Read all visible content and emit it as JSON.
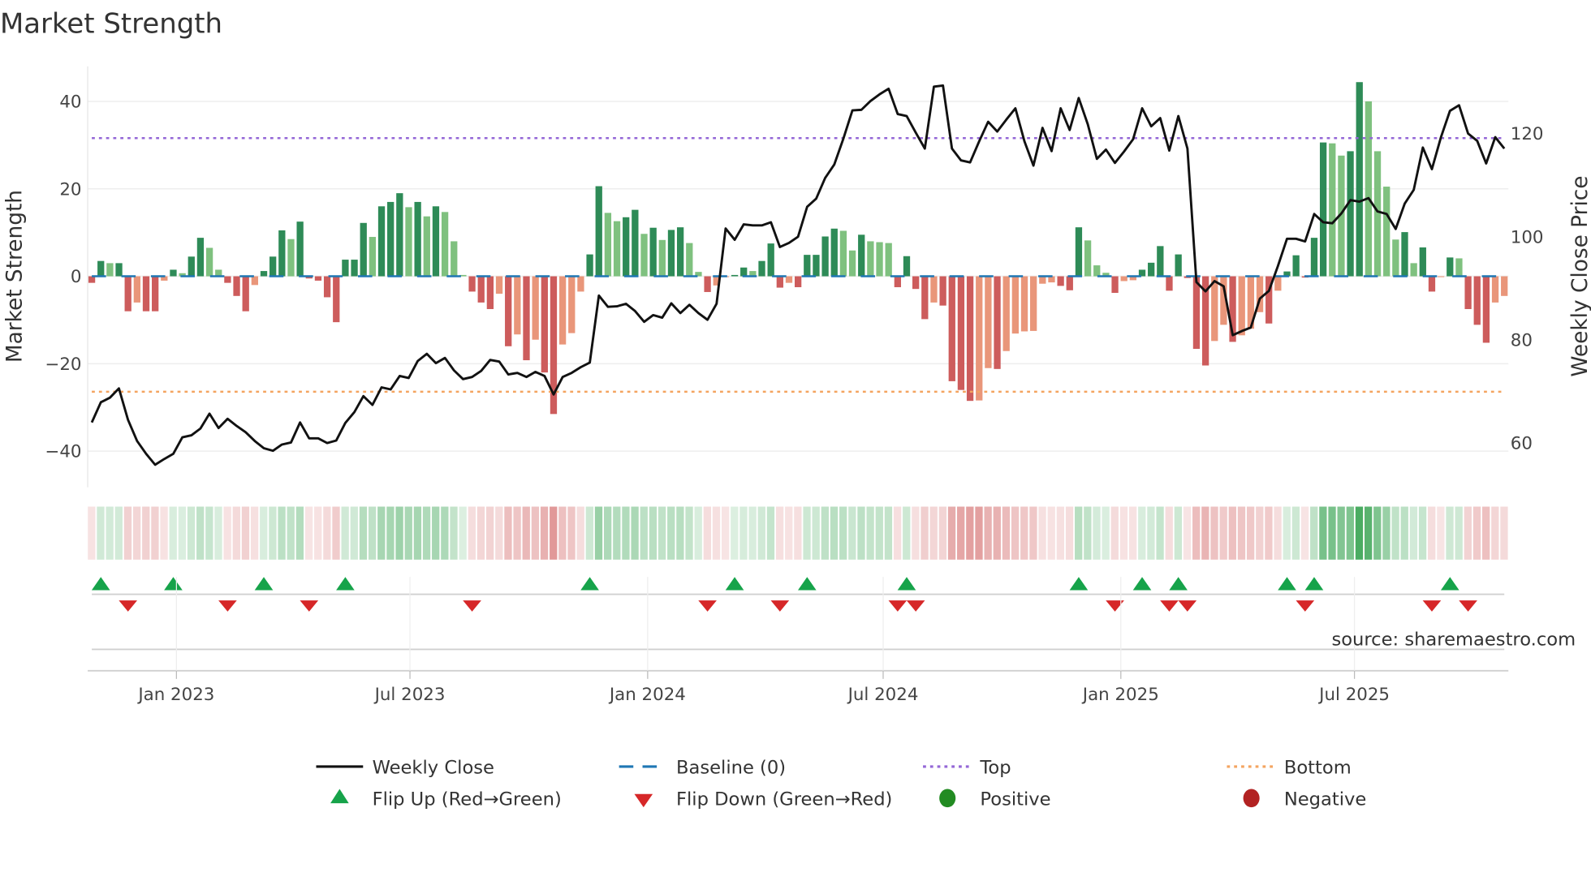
{
  "chart_data": {
    "type": "bar",
    "title": "Market Strength",
    "ylabel": "Market Strength",
    "y2label": "Weekly Close Price",
    "frequency": "weekly",
    "ylim": [
      -48,
      48
    ],
    "y2lim": [
      52,
      136
    ],
    "y_ticks": [
      40,
      20,
      0,
      -20,
      -40
    ],
    "y_tick_labels": [
      "40",
      "20",
      "0",
      "−20",
      "−40"
    ],
    "y2_ticks": [
      120,
      100,
      80,
      60
    ],
    "y2_tick_labels": [
      "120",
      "100",
      "80",
      "60"
    ],
    "x_ticks": [
      {
        "label": "Jan 2023",
        "week": 9.35
      },
      {
        "label": "Jul 2023",
        "week": 35.14
      },
      {
        "label": "Jan 2024",
        "week": 61.39
      },
      {
        "label": "Jul 2024",
        "week": 87.4
      },
      {
        "label": "Jan 2025",
        "week": 113.65
      },
      {
        "label": "Jul 2025",
        "week": 139.45
      }
    ],
    "top_level": 31.6,
    "bottom_level": -26.4,
    "baseline": 0,
    "strength": [
      -1.5,
      3.5,
      3,
      3,
      -8,
      -6,
      -8,
      -8,
      -1,
      1.5,
      0.7,
      4.5,
      8.8,
      6.5,
      1.5,
      -1.5,
      -4.5,
      -8,
      -2,
      1.2,
      4.5,
      10.5,
      8.5,
      12.5,
      -0.5,
      -1,
      -4.8,
      -10.5,
      3.8,
      3.8,
      12.2,
      9,
      16,
      17,
      19,
      15.8,
      17,
      13.7,
      16,
      14.7,
      8,
      0.3,
      -3.5,
      -6,
      -7.5,
      -4,
      -16,
      -13.3,
      -19.2,
      -14.5,
      -22,
      -31.5,
      -15.6,
      -13,
      -3.5,
      5,
      20.6,
      14.5,
      12.6,
      13.5,
      15.2,
      9.7,
      11.1,
      8.3,
      10.6,
      11.2,
      7.6,
      1,
      -3.6,
      -2.1,
      -0.2,
      0.3,
      2,
      1.2,
      3.5,
      7.5,
      -2.6,
      -1.5,
      -2.5,
      4.9,
      4.9,
      9.1,
      10.9,
      10.4,
      5.9,
      9.5,
      8,
      7.8,
      7.6,
      -2.5,
      4.6,
      -2.9,
      -9.8,
      -6,
      -6.7,
      -24,
      -26,
      -28.5,
      -28.4,
      -21,
      -21.2,
      -17.1,
      -13.1,
      -12.6,
      -12.5,
      -1.7,
      -1.4,
      -2.2,
      -3.2,
      11.2,
      8.2,
      2.5,
      0.8,
      -3.8,
      -1.1,
      -0.9,
      1.5,
      3.1,
      6.9,
      -3.3,
      5,
      -0.4,
      -16.6,
      -20.4,
      -14.8,
      -11.1,
      -15,
      -13.5,
      -12,
      -8.2,
      -10.8,
      -3.3,
      1.1,
      4.8,
      -0.3,
      8.8,
      30.6,
      30.4,
      27.6,
      28.6,
      44.4,
      40,
      28.6,
      20.5,
      8.4,
      10.1,
      3,
      6.6,
      -3.5,
      -0.2,
      4.3,
      4.1,
      -7.5,
      -11.1,
      -15.2,
      -6,
      -4.5
    ],
    "weekly_close": [
      64.0,
      67.9,
      68.8,
      70.6,
      64.5,
      60.4,
      57.9,
      55.8,
      56.9,
      57.9,
      61.1,
      61.5,
      62.8,
      65.7,
      62.9,
      64.7,
      63.3,
      62.1,
      60.4,
      59.0,
      58.5,
      59.7,
      60.1,
      64.0,
      60.9,
      60.9,
      60.0,
      60.5,
      63.9,
      66.0,
      69.1,
      67.4,
      70.8,
      70.4,
      73.0,
      72.6,
      75.9,
      77.3,
      75.5,
      76.5,
      74.1,
      72.4,
      72.8,
      74.0,
      76.1,
      75.8,
      73.3,
      73.6,
      72.8,
      73.8,
      73.0,
      69.4,
      72.8,
      73.6,
      74.7,
      75.6,
      88.6,
      86.4,
      86.5,
      87.0,
      85.6,
      83.5,
      84.8,
      84.3,
      87.1,
      85.2,
      86.8,
      85.2,
      83.9,
      87.0,
      101.6,
      99.4,
      102.4,
      102.2,
      102.2,
      102.8,
      98.0,
      98.8,
      100.0,
      105.8,
      107.4,
      111.4,
      114.0,
      119.0,
      124.5,
      124.6,
      126.3,
      127.6,
      128.7,
      123.8,
      123.4,
      120.2,
      117.1,
      129.1,
      129.3,
      117.1,
      114.8,
      114.4,
      118.5,
      122.3,
      120.4,
      122.7,
      124.9,
      118.5,
      113.8,
      121.1,
      116.6,
      124.9,
      120.7,
      126.9,
      121.8,
      115.1,
      116.9,
      114.3,
      116.5,
      118.9,
      124.9,
      121.4,
      123.0,
      116.7,
      123.4,
      117.1,
      91.2,
      89.4,
      91.4,
      90.4,
      80.9,
      81.7,
      82.4,
      88.0,
      89.5,
      94.3,
      99.6,
      99.6,
      99.1,
      104.4,
      102.8,
      102.6,
      104.5,
      107.1,
      106.8,
      107.5,
      104.9,
      104.4,
      101.5,
      106.4,
      109.1,
      117.3,
      113.1,
      119.3,
      124.4,
      125.5,
      120.0,
      118.6,
      114.2,
      119.3,
      117.1
    ],
    "flip_up_weeks": [
      1,
      9,
      19,
      28,
      55,
      71,
      79,
      90,
      109,
      116,
      120,
      132,
      135,
      150
    ],
    "flip_down_weeks": [
      4,
      15,
      24,
      42,
      68,
      76,
      89,
      91,
      113,
      119,
      121,
      134,
      148,
      152
    ],
    "legend": {
      "weekly_close": "Weekly Close",
      "baseline": "Baseline (0)",
      "top": "Top",
      "bottom": "Bottom",
      "flip_up": "Flip Up (Red→Green)",
      "flip_down": "Flip Down (Green→Red)",
      "positive": "Positive",
      "negative": "Negative"
    },
    "legend_position": "bottom-center",
    "grid": true,
    "source": "source: sharemaestro.com"
  },
  "colors": {
    "pos_rising": "#2e8b57",
    "pos_falling": "#7fc17f",
    "neg_falling": "#cd5c5c",
    "neg_rising": "#e9967a",
    "price": "#111111",
    "baseline": "#1f77b4",
    "top": "#9467d7",
    "bottom": "#f4a460",
    "flip_up": "#16a34a",
    "flip_down": "#d62728",
    "positive": "#228b22",
    "negative": "#b22222"
  }
}
